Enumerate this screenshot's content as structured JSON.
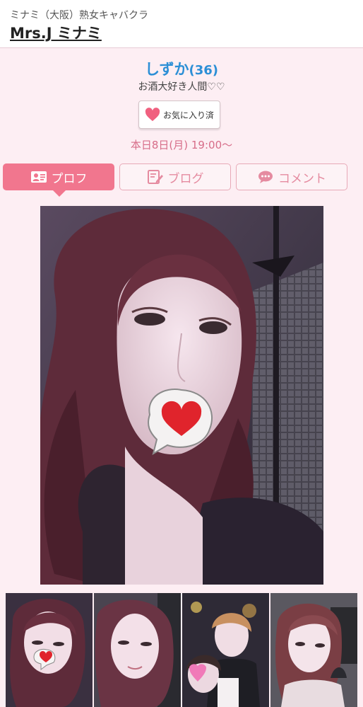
{
  "header": {
    "shop_sub": "ミナミ（大阪）熟女キャバクラ",
    "shop_name": "Mrs.J ミナミ"
  },
  "profile": {
    "name": "しずか",
    "age": "(36)",
    "catch_copy": "お酒大好き人間♡♡",
    "favorite_label": "お気に入り済",
    "schedule": "本日8日(月) 19:00〜"
  },
  "tabs": [
    {
      "label": "プロフ",
      "icon": "profile-card-icon",
      "active": true
    },
    {
      "label": "ブログ",
      "icon": "blog-pencil-icon",
      "active": false
    },
    {
      "label": "コメント",
      "icon": "chat-bubble-icon",
      "active": false
    }
  ],
  "photos": {
    "main": "main-profile-photo",
    "thumbnails": [
      "thumb-1",
      "thumb-2",
      "thumb-3",
      "thumb-4"
    ]
  },
  "colors": {
    "accent_pink": "#f1768e",
    "name_blue": "#2c8fd6",
    "schedule_pink": "#d76d89",
    "page_bg": "#fdeef3"
  }
}
